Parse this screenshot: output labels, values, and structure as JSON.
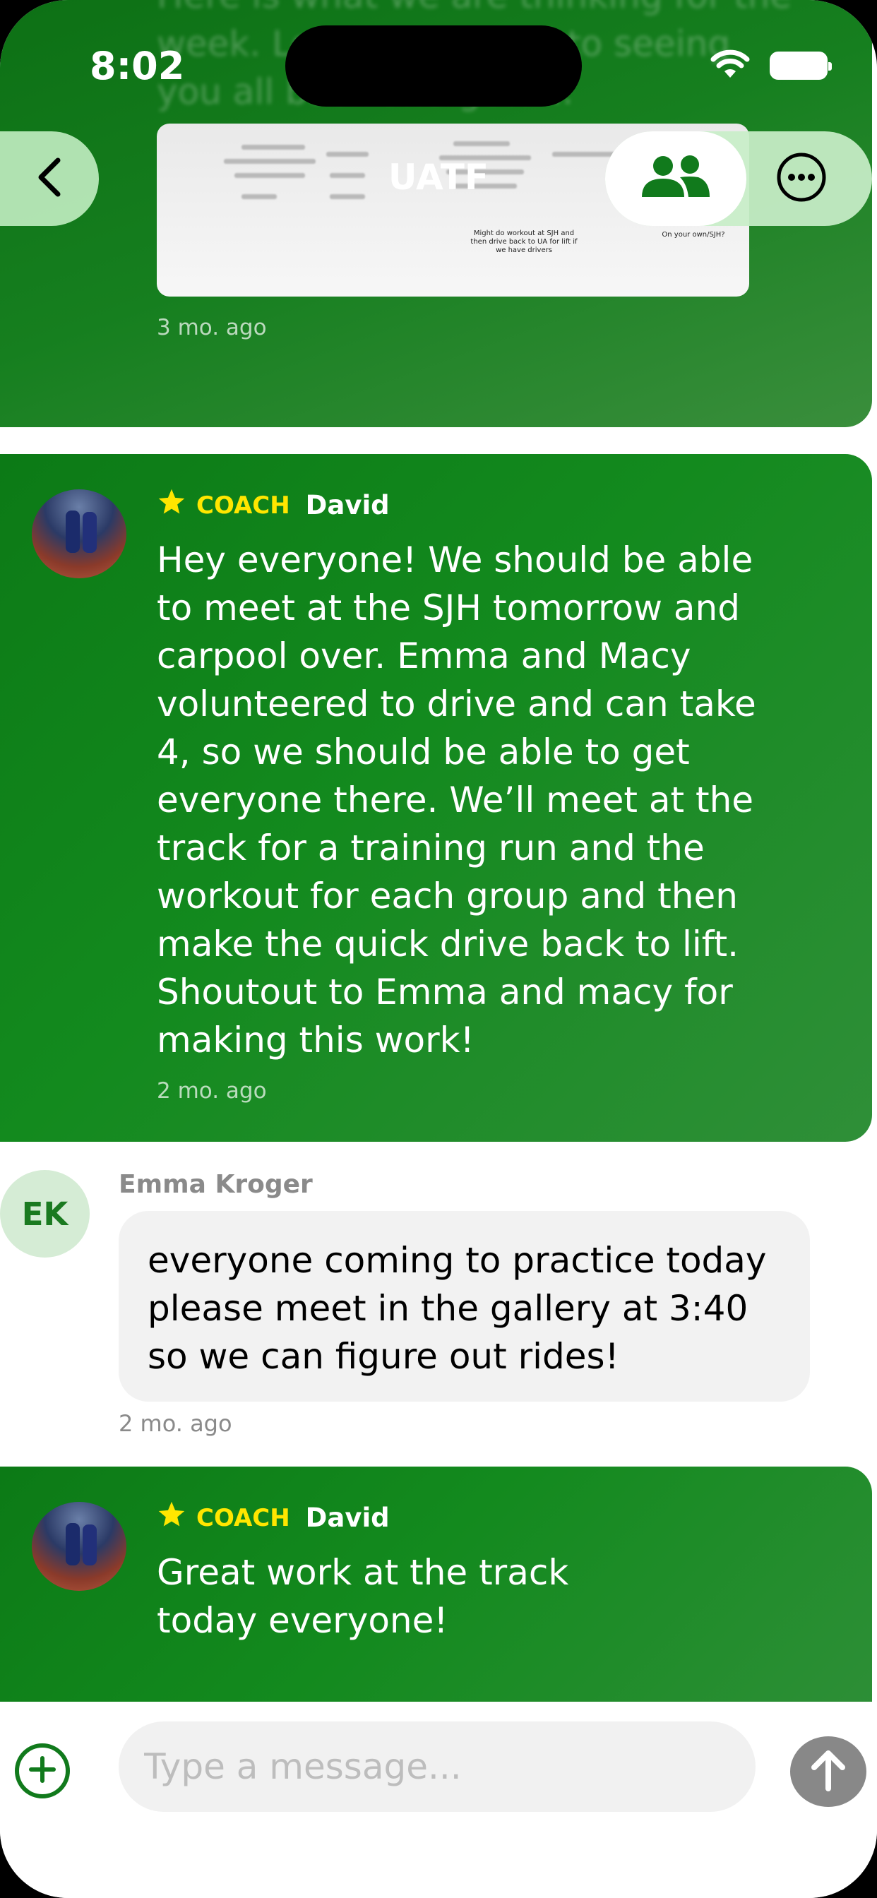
{
  "status_bar": {
    "time": "8:02"
  },
  "nav": {
    "title": "UATF"
  },
  "messages": [
    {
      "faded_text": "Here is what we are thinking for the week. Looking forward to seeing you all back and getti...",
      "attachment": {
        "note_1": "Might do workout at SJH and then drive back to UA for lift if we have drivers",
        "note_2": "On your own/SJH?"
      },
      "timestamp": "3 mo. ago"
    },
    {
      "badge": "COACH",
      "author": "David",
      "text": "Hey everyone! We should be able to meet at the SJH tomorrow and carpool over. Emma and Macy volunteered to drive and can take 4, so we should be able to get everyone there. We’ll meet at the track for a training run and the workout for each group and then make the quick drive back to lift. Shoutout to Emma and macy for making this work!",
      "timestamp": "2 mo. ago"
    },
    {
      "initials": "EK",
      "author": "Emma Kroger",
      "text": "everyone coming to practice today please meet in the gallery at 3:40 so we can figure out rides!",
      "timestamp": "2 mo. ago"
    },
    {
      "badge": "COACH",
      "author": "David",
      "text": "Great work at the track today everyone!"
    }
  ],
  "composer": {
    "placeholder": "Type a message..."
  },
  "colors": {
    "accent": "#117a1c",
    "coach_badge": "#ffe600",
    "bubble_grey": "#f2f2f2"
  }
}
